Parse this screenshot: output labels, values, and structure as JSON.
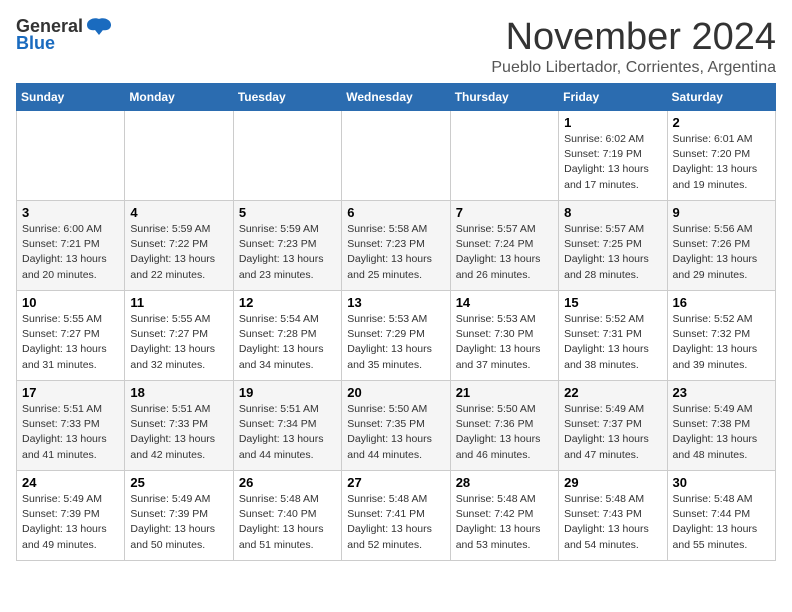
{
  "logo": {
    "general": "General",
    "blue": "Blue"
  },
  "title": "November 2024",
  "subtitle": "Pueblo Libertador, Corrientes, Argentina",
  "headers": [
    "Sunday",
    "Monday",
    "Tuesday",
    "Wednesday",
    "Thursday",
    "Friday",
    "Saturday"
  ],
  "weeks": [
    [
      {
        "day": "",
        "info": ""
      },
      {
        "day": "",
        "info": ""
      },
      {
        "day": "",
        "info": ""
      },
      {
        "day": "",
        "info": ""
      },
      {
        "day": "",
        "info": ""
      },
      {
        "day": "1",
        "info": "Sunrise: 6:02 AM\nSunset: 7:19 PM\nDaylight: 13 hours\nand 17 minutes."
      },
      {
        "day": "2",
        "info": "Sunrise: 6:01 AM\nSunset: 7:20 PM\nDaylight: 13 hours\nand 19 minutes."
      }
    ],
    [
      {
        "day": "3",
        "info": "Sunrise: 6:00 AM\nSunset: 7:21 PM\nDaylight: 13 hours\nand 20 minutes."
      },
      {
        "day": "4",
        "info": "Sunrise: 5:59 AM\nSunset: 7:22 PM\nDaylight: 13 hours\nand 22 minutes."
      },
      {
        "day": "5",
        "info": "Sunrise: 5:59 AM\nSunset: 7:23 PM\nDaylight: 13 hours\nand 23 minutes."
      },
      {
        "day": "6",
        "info": "Sunrise: 5:58 AM\nSunset: 7:23 PM\nDaylight: 13 hours\nand 25 minutes."
      },
      {
        "day": "7",
        "info": "Sunrise: 5:57 AM\nSunset: 7:24 PM\nDaylight: 13 hours\nand 26 minutes."
      },
      {
        "day": "8",
        "info": "Sunrise: 5:57 AM\nSunset: 7:25 PM\nDaylight: 13 hours\nand 28 minutes."
      },
      {
        "day": "9",
        "info": "Sunrise: 5:56 AM\nSunset: 7:26 PM\nDaylight: 13 hours\nand 29 minutes."
      }
    ],
    [
      {
        "day": "10",
        "info": "Sunrise: 5:55 AM\nSunset: 7:27 PM\nDaylight: 13 hours\nand 31 minutes."
      },
      {
        "day": "11",
        "info": "Sunrise: 5:55 AM\nSunset: 7:27 PM\nDaylight: 13 hours\nand 32 minutes."
      },
      {
        "day": "12",
        "info": "Sunrise: 5:54 AM\nSunset: 7:28 PM\nDaylight: 13 hours\nand 34 minutes."
      },
      {
        "day": "13",
        "info": "Sunrise: 5:53 AM\nSunset: 7:29 PM\nDaylight: 13 hours\nand 35 minutes."
      },
      {
        "day": "14",
        "info": "Sunrise: 5:53 AM\nSunset: 7:30 PM\nDaylight: 13 hours\nand 37 minutes."
      },
      {
        "day": "15",
        "info": "Sunrise: 5:52 AM\nSunset: 7:31 PM\nDaylight: 13 hours\nand 38 minutes."
      },
      {
        "day": "16",
        "info": "Sunrise: 5:52 AM\nSunset: 7:32 PM\nDaylight: 13 hours\nand 39 minutes."
      }
    ],
    [
      {
        "day": "17",
        "info": "Sunrise: 5:51 AM\nSunset: 7:33 PM\nDaylight: 13 hours\nand 41 minutes."
      },
      {
        "day": "18",
        "info": "Sunrise: 5:51 AM\nSunset: 7:33 PM\nDaylight: 13 hours\nand 42 minutes."
      },
      {
        "day": "19",
        "info": "Sunrise: 5:51 AM\nSunset: 7:34 PM\nDaylight: 13 hours\nand 44 minutes."
      },
      {
        "day": "20",
        "info": "Sunrise: 5:50 AM\nSunset: 7:35 PM\nDaylight: 13 hours\nand 44 minutes."
      },
      {
        "day": "21",
        "info": "Sunrise: 5:50 AM\nSunset: 7:36 PM\nDaylight: 13 hours\nand 46 minutes."
      },
      {
        "day": "22",
        "info": "Sunrise: 5:49 AM\nSunset: 7:37 PM\nDaylight: 13 hours\nand 47 minutes."
      },
      {
        "day": "23",
        "info": "Sunrise: 5:49 AM\nSunset: 7:38 PM\nDaylight: 13 hours\nand 48 minutes."
      }
    ],
    [
      {
        "day": "24",
        "info": "Sunrise: 5:49 AM\nSunset: 7:39 PM\nDaylight: 13 hours\nand 49 minutes."
      },
      {
        "day": "25",
        "info": "Sunrise: 5:49 AM\nSunset: 7:39 PM\nDaylight: 13 hours\nand 50 minutes."
      },
      {
        "day": "26",
        "info": "Sunrise: 5:48 AM\nSunset: 7:40 PM\nDaylight: 13 hours\nand 51 minutes."
      },
      {
        "day": "27",
        "info": "Sunrise: 5:48 AM\nSunset: 7:41 PM\nDaylight: 13 hours\nand 52 minutes."
      },
      {
        "day": "28",
        "info": "Sunrise: 5:48 AM\nSunset: 7:42 PM\nDaylight: 13 hours\nand 53 minutes."
      },
      {
        "day": "29",
        "info": "Sunrise: 5:48 AM\nSunset: 7:43 PM\nDaylight: 13 hours\nand 54 minutes."
      },
      {
        "day": "30",
        "info": "Sunrise: 5:48 AM\nSunset: 7:44 PM\nDaylight: 13 hours\nand 55 minutes."
      }
    ]
  ]
}
